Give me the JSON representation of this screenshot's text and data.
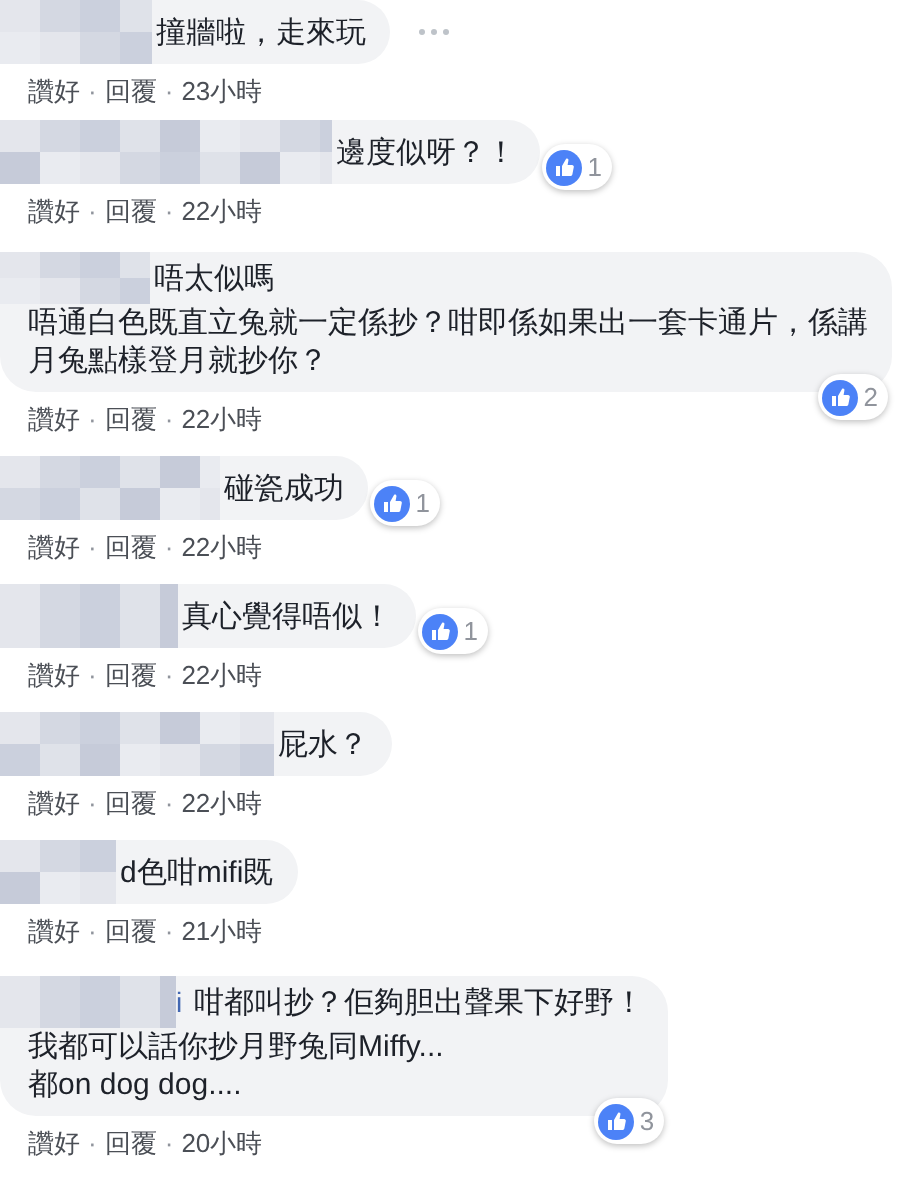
{
  "separator": "·",
  "comments": [
    {
      "lines": [
        "撞牆啦，走來玩"
      ],
      "more": true,
      "actions": [
        "讚好",
        "回覆"
      ],
      "time": "23小時"
    },
    {
      "lines": [
        "邊度似呀？！"
      ],
      "likes": "1",
      "more": false,
      "actions": [
        "讚好",
        "回覆"
      ],
      "time": "22小時"
    },
    {
      "lines": [
        "唔太似嗎",
        "唔通白色既直立兔就一定係抄？咁即係如果出一套卡通片，係講",
        "月兔點樣登月就抄你？"
      ],
      "likes": "2",
      "more": false,
      "actions": [
        "讚好",
        "回覆"
      ],
      "time": "22小時"
    },
    {
      "lines": [
        "碰瓷成功"
      ],
      "likes": "1",
      "more": false,
      "actions": [
        "讚好",
        "回覆"
      ],
      "time": "22小時"
    },
    {
      "lines": [
        "真心覺得唔似！"
      ],
      "likes": "1",
      "more": false,
      "actions": [
        "讚好",
        "回覆"
      ],
      "time": "22小時"
    },
    {
      "lines": [
        "屁水？"
      ],
      "more": false,
      "actions": [
        "讚好",
        "回覆"
      ],
      "time": "22小時"
    },
    {
      "lines": [
        "d色咁mifi既"
      ],
      "more": false,
      "actions": [
        "讚好",
        "回覆"
      ],
      "time": "21小時"
    },
    {
      "name_tail": "i",
      "lines": [
        "咁都叫抄？佢夠胆出聲果下好野！",
        "我都可以話你抄月野兔同Miffy...",
        "都on dog dog...."
      ],
      "likes": "3",
      "more": false,
      "actions": [
        "讚好",
        "回覆"
      ],
      "time": "20小時"
    }
  ]
}
